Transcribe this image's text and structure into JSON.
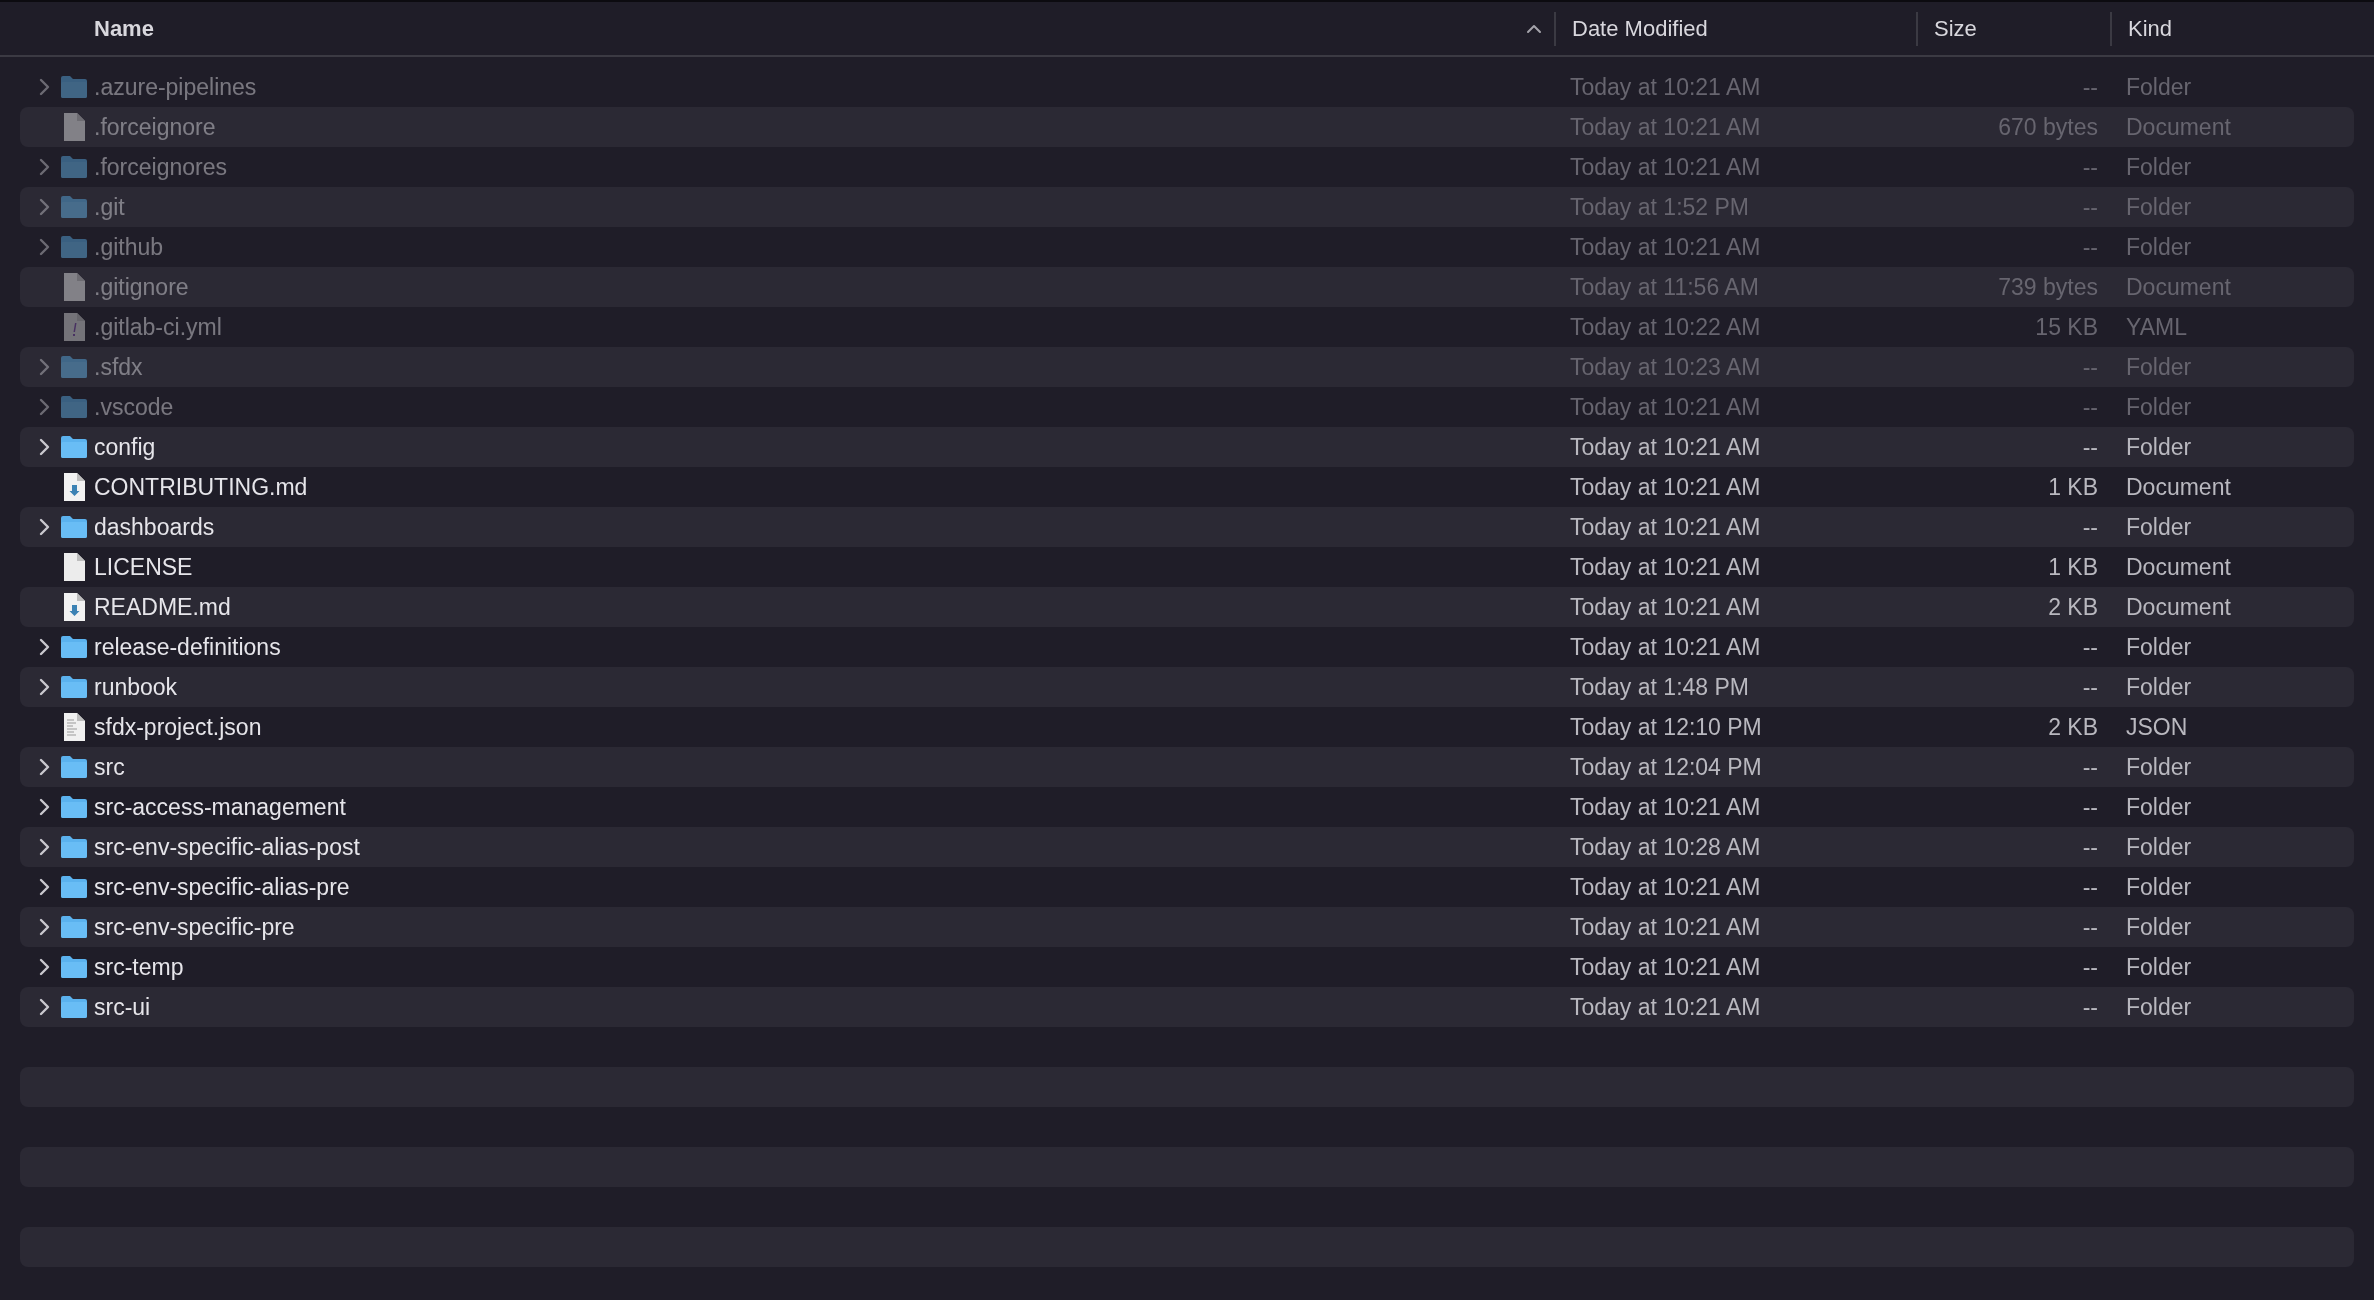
{
  "columns": [
    {
      "label": "Name",
      "sorted": true
    },
    {
      "label": "Date Modified",
      "sorted": false
    },
    {
      "label": "Size",
      "sorted": false
    },
    {
      "label": "Kind",
      "sorted": false
    }
  ],
  "rows": [
    {
      "name": ".azure-pipelines",
      "kind": "folder",
      "hidden": true,
      "date": "Today at 10:21 AM",
      "size": "--",
      "type": "Folder"
    },
    {
      "name": ".forceignore",
      "kind": "file",
      "hidden": true,
      "date": "Today at 10:21 AM",
      "size": "670 bytes",
      "type": "Document"
    },
    {
      "name": ".forceignores",
      "kind": "folder",
      "hidden": true,
      "date": "Today at 10:21 AM",
      "size": "--",
      "type": "Folder"
    },
    {
      "name": ".git",
      "kind": "folder",
      "hidden": true,
      "date": "Today at 1:52 PM",
      "size": "--",
      "type": "Folder"
    },
    {
      "name": ".github",
      "kind": "folder",
      "hidden": true,
      "date": "Today at 10:21 AM",
      "size": "--",
      "type": "Folder"
    },
    {
      "name": ".gitignore",
      "kind": "file",
      "hidden": true,
      "date": "Today at 11:56 AM",
      "size": "739 bytes",
      "type": "Document"
    },
    {
      "name": ".gitlab-ci.yml",
      "kind": "yaml",
      "hidden": true,
      "date": "Today at 10:22 AM",
      "size": "15 KB",
      "type": "YAML"
    },
    {
      "name": ".sfdx",
      "kind": "folder",
      "hidden": true,
      "date": "Today at 10:23 AM",
      "size": "--",
      "type": "Folder"
    },
    {
      "name": ".vscode",
      "kind": "folder",
      "hidden": true,
      "date": "Today at 10:21 AM",
      "size": "--",
      "type": "Folder"
    },
    {
      "name": "config",
      "kind": "folder",
      "hidden": false,
      "date": "Today at 10:21 AM",
      "size": "--",
      "type": "Folder"
    },
    {
      "name": "CONTRIBUTING.md",
      "kind": "markdown",
      "hidden": false,
      "date": "Today at 10:21 AM",
      "size": "1 KB",
      "type": "Document"
    },
    {
      "name": "dashboards",
      "kind": "folder",
      "hidden": false,
      "date": "Today at 10:21 AM",
      "size": "--",
      "type": "Folder"
    },
    {
      "name": "LICENSE",
      "kind": "file",
      "hidden": false,
      "date": "Today at 10:21 AM",
      "size": "1 KB",
      "type": "Document"
    },
    {
      "name": "README.md",
      "kind": "markdown",
      "hidden": false,
      "date": "Today at 10:21 AM",
      "size": "2 KB",
      "type": "Document"
    },
    {
      "name": "release-definitions",
      "kind": "folder",
      "hidden": false,
      "date": "Today at 10:21 AM",
      "size": "--",
      "type": "Folder"
    },
    {
      "name": "runbook",
      "kind": "folder",
      "hidden": false,
      "date": "Today at 1:48 PM",
      "size": "--",
      "type": "Folder"
    },
    {
      "name": "sfdx-project.json",
      "kind": "json",
      "hidden": false,
      "date": "Today at 12:10 PM",
      "size": "2 KB",
      "type": "JSON"
    },
    {
      "name": "src",
      "kind": "folder",
      "hidden": false,
      "date": "Today at 12:04 PM",
      "size": "--",
      "type": "Folder"
    },
    {
      "name": "src-access-management",
      "kind": "folder",
      "hidden": false,
      "date": "Today at 10:21 AM",
      "size": "--",
      "type": "Folder"
    },
    {
      "name": "src-env-specific-alias-post",
      "kind": "folder",
      "hidden": false,
      "date": "Today at 10:28 AM",
      "size": "--",
      "type": "Folder"
    },
    {
      "name": "src-env-specific-alias-pre",
      "kind": "folder",
      "hidden": false,
      "date": "Today at 10:21 AM",
      "size": "--",
      "type": "Folder"
    },
    {
      "name": "src-env-specific-pre",
      "kind": "folder",
      "hidden": false,
      "date": "Today at 10:21 AM",
      "size": "--",
      "type": "Folder"
    },
    {
      "name": "src-temp",
      "kind": "folder",
      "hidden": false,
      "date": "Today at 10:21 AM",
      "size": "--",
      "type": "Folder"
    },
    {
      "name": "src-ui",
      "kind": "folder",
      "hidden": false,
      "date": "Today at 10:21 AM",
      "size": "--",
      "type": "Folder"
    }
  ]
}
